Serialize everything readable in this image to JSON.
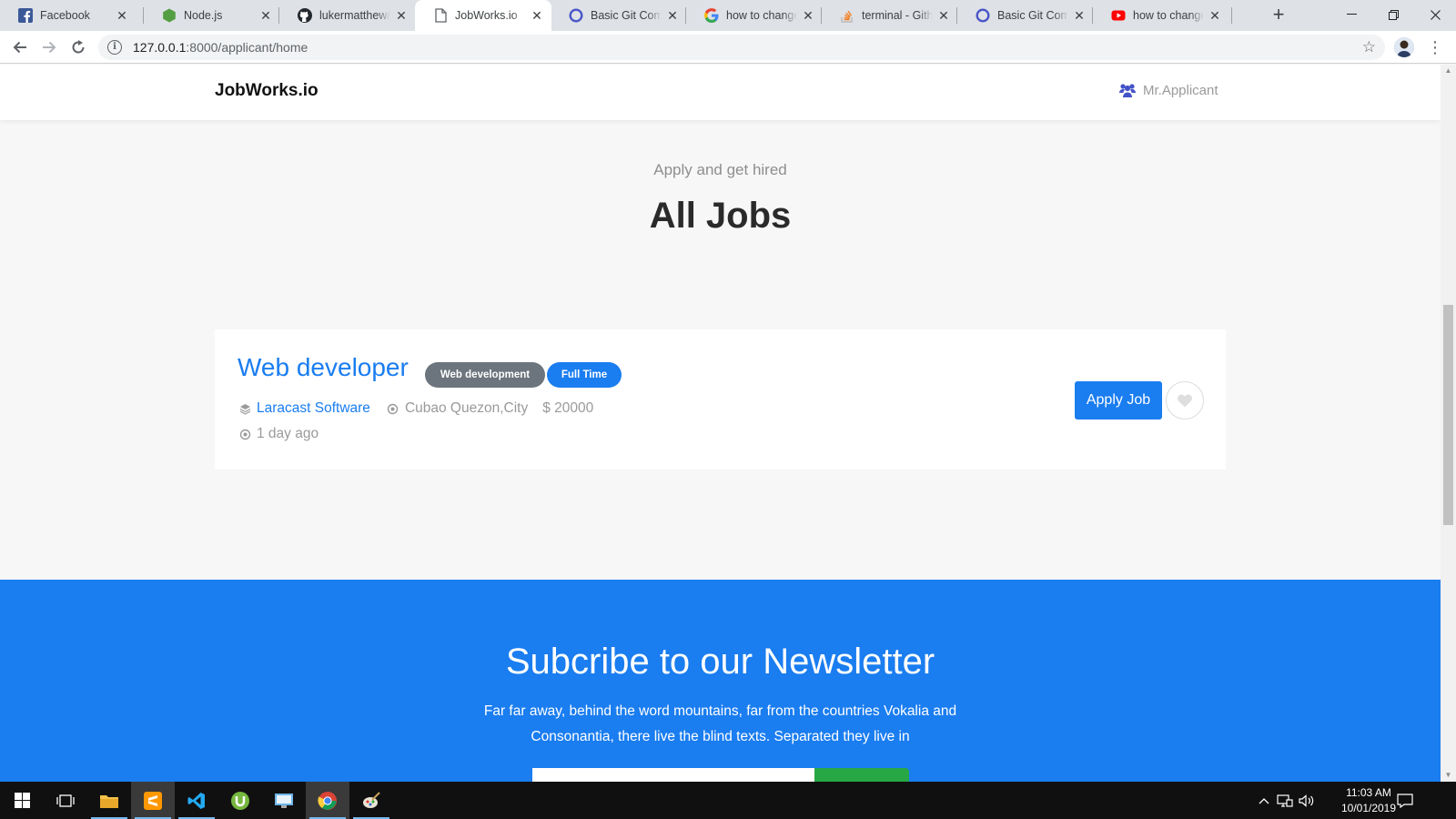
{
  "browser": {
    "tabs": [
      {
        "title": "Facebook",
        "icon": "facebook-icon"
      },
      {
        "title": "Node.js",
        "icon": "nodejs-icon"
      },
      {
        "title": "lukermatthew/Jo",
        "icon": "github-icon"
      },
      {
        "title": "JobWorks.io",
        "icon": "page-icon",
        "active": true
      },
      {
        "title": "Basic Git Comma",
        "icon": "circle-icon"
      },
      {
        "title": "how to change t",
        "icon": "google-icon"
      },
      {
        "title": "terminal - Githu",
        "icon": "stackoverflow-icon"
      },
      {
        "title": "Basic Git Comma",
        "icon": "circle-icon"
      },
      {
        "title": "how to change n",
        "icon": "youtube-icon"
      }
    ],
    "url_host": "127.0.0.1",
    "url_path": ":8000/applicant/home"
  },
  "site": {
    "brand": "JobWorks.io",
    "user_name": "Mr.Applicant",
    "subtitle": "Apply and get hired",
    "heading": "All Jobs"
  },
  "job": {
    "title": "Web developer",
    "category": "Web development",
    "type": "Full Time",
    "company": "Laracast Software",
    "location": "Cubao Quezon,City",
    "salary": "$ 20000",
    "posted": "1 day ago",
    "apply_label": "Apply Job"
  },
  "newsletter": {
    "title": "Subcribe to our Newsletter",
    "text": "Far far away, behind the word mountains, far from the countries Vokalia and Consonantia, there live the blind texts. Separated they live in"
  },
  "taskbar": {
    "time": "11:03 AM",
    "date": "10/01/2019"
  },
  "colors": {
    "primary": "#1a7df0",
    "badge_gray": "#6c757d",
    "success": "#28a745"
  }
}
